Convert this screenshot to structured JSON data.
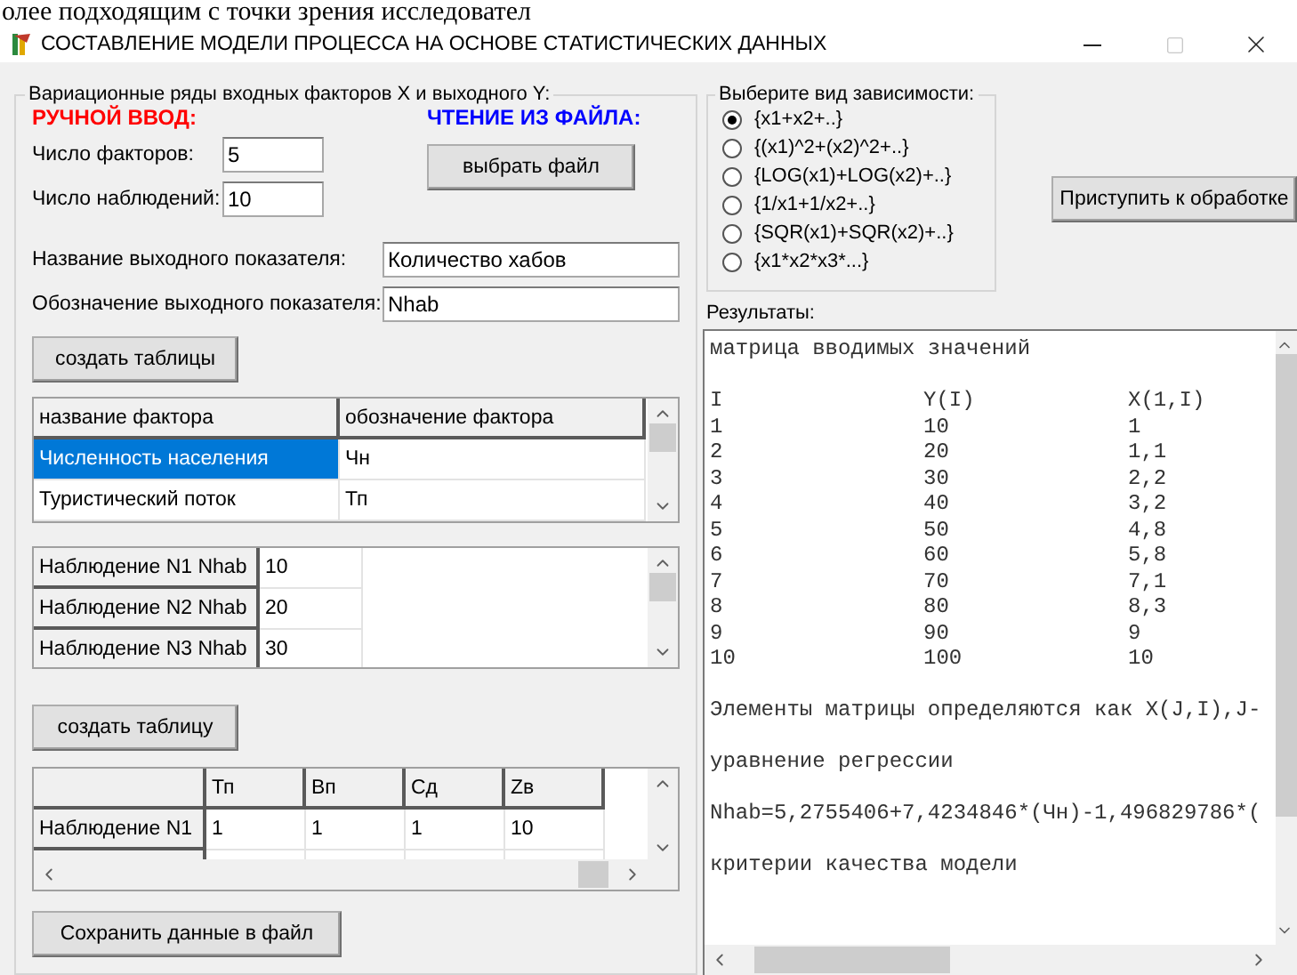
{
  "document_fragment": "олее подходящим с точки зрения исследовател",
  "window": {
    "title": "СОСТАВЛЕНИЕ МОДЕЛИ ПРОЦЕССА НА ОСНОВЕ СТАТИСТИЧЕСКИХ ДАННЫХ"
  },
  "input_group": {
    "title": "Вариационные ряды входных факторов X и выходного Y:",
    "manual_label": "РУЧНОЙ ВВОД:",
    "file_label": "ЧТЕНИЕ ИЗ ФАЙЛА:",
    "count_fields": [
      {
        "label": "Число факторов:",
        "value": "5"
      },
      {
        "label": "Число наблюдений:",
        "value": "10"
      }
    ],
    "choose_file_button": "выбрать файл",
    "output_fields": [
      {
        "label": "Название выходного показателя:",
        "value": "Количество хабов"
      },
      {
        "label": "Обозначение выходного показателя:",
        "value": "Nhab"
      }
    ],
    "create_tables_button": "создать таблицы",
    "factors_table": {
      "columns": [
        "название фактора",
        "обозначение фактора"
      ],
      "rows": [
        {
          "cells": [
            "Численность населения",
            "Чн"
          ],
          "selected": true
        },
        {
          "cells": [
            "Туристический поток",
            "Тп"
          ],
          "selected": false
        }
      ]
    },
    "observations_table": {
      "rows": [
        {
          "label": "Наблюдение N1 Nhab",
          "value": "10"
        },
        {
          "label": "Наблюдение N2 Nhab",
          "value": "20"
        },
        {
          "label": "Наблюдение N3 Nhab",
          "value": "30"
        }
      ]
    },
    "create_table_button": "создать таблицу",
    "matrix_table": {
      "columns": [
        "Тп",
        "Вп",
        "Сд",
        "Zв"
      ],
      "rows": [
        {
          "label": "Наблюдение N1",
          "cells": [
            "1",
            "1",
            "1",
            "10"
          ]
        }
      ]
    },
    "save_button": "Сохранить данные в файл"
  },
  "dependency_group": {
    "title": "Выберите вид зависимости:",
    "options": [
      {
        "label": "{x1+x2+..}",
        "selected": true
      },
      {
        "label": "{(x1)^2+(x2)^2+..}",
        "selected": false
      },
      {
        "label": "{LOG(x1)+LOG(x2)+..}",
        "selected": false
      },
      {
        "label": "{1/x1+1/x2+..}",
        "selected": false
      },
      {
        "label": "{SQR(x1)+SQR(x2)+..}",
        "selected": false
      },
      {
        "label": "{x1*x2*x3*...}",
        "selected": false
      }
    ]
  },
  "process_button": "Приступить к обработке",
  "results": {
    "label": "Результаты:",
    "lines": [
      {
        "kind": "text",
        "text": "матрица вводимых значений"
      },
      {
        "kind": "blank"
      },
      {
        "kind": "columns",
        "cells": [
          "I",
          "Y(I)",
          "X(1,I)"
        ]
      },
      {
        "kind": "columns",
        "cells": [
          "1",
          "10",
          "1"
        ]
      },
      {
        "kind": "columns",
        "cells": [
          "2",
          "20",
          "1,1"
        ]
      },
      {
        "kind": "columns",
        "cells": [
          "3",
          "30",
          "2,2"
        ]
      },
      {
        "kind": "columns",
        "cells": [
          "4",
          "40",
          "3,2"
        ]
      },
      {
        "kind": "columns",
        "cells": [
          "5",
          "50",
          "4,8"
        ]
      },
      {
        "kind": "columns",
        "cells": [
          "6",
          "60",
          "5,8"
        ]
      },
      {
        "kind": "columns",
        "cells": [
          "7",
          "70",
          "7,1"
        ]
      },
      {
        "kind": "columns",
        "cells": [
          "8",
          "80",
          "8,3"
        ]
      },
      {
        "kind": "columns",
        "cells": [
          "9",
          "90",
          "9"
        ]
      },
      {
        "kind": "columns",
        "cells": [
          "10",
          "100",
          "10"
        ]
      },
      {
        "kind": "blank"
      },
      {
        "kind": "text",
        "text": "Элементы матрицы определяются как X(J,I),J-"
      },
      {
        "kind": "blank"
      },
      {
        "kind": "text",
        "text": "уравнение регрессии"
      },
      {
        "kind": "blank"
      },
      {
        "kind": "text",
        "text": "Nhab=5,2755406+7,4234846*(Чн)-1,496829786*("
      },
      {
        "kind": "blank"
      },
      {
        "kind": "text",
        "text": "критерии качества модели"
      }
    ]
  }
}
